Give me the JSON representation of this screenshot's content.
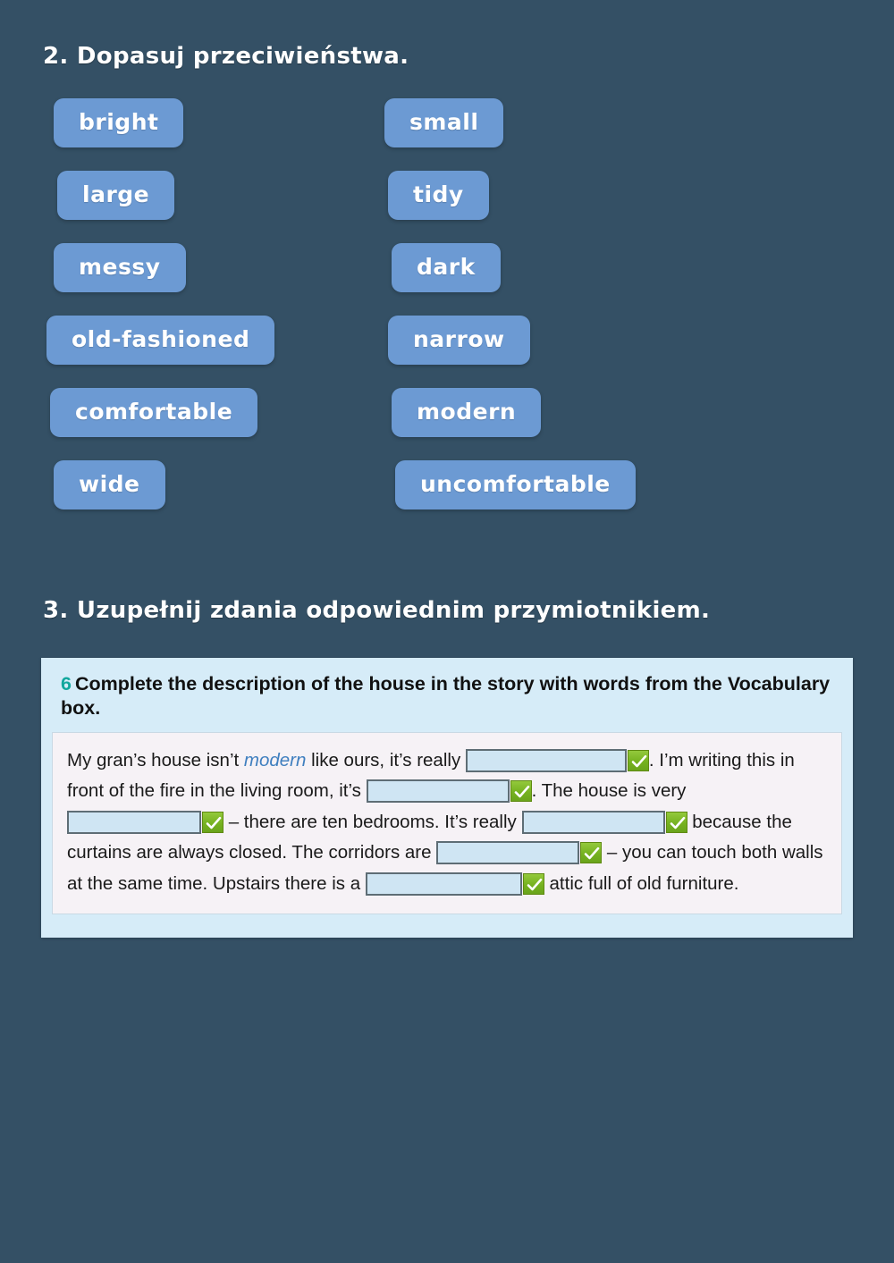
{
  "page": {
    "background_color": "#345065",
    "word_box_color": "#6c9ad3",
    "panel_color": "#d6ecf8",
    "panel_body_color": "#f6f2f6",
    "accent_color": "#12a79d",
    "check_color": "#76b220"
  },
  "exercise2": {
    "heading": "2. Dopasuj przeciwieństwa.",
    "left_column": [
      {
        "label": "bright"
      },
      {
        "label": "large"
      },
      {
        "label": "messy"
      },
      {
        "label": "old-fashioned"
      },
      {
        "label": "comfortable"
      },
      {
        "label": "wide"
      }
    ],
    "right_column": [
      {
        "label": "small"
      },
      {
        "label": "tidy"
      },
      {
        "label": "dark"
      },
      {
        "label": "narrow"
      },
      {
        "label": "modern"
      },
      {
        "label": "uncomfortable"
      }
    ]
  },
  "exercise3": {
    "heading": "3. Uzupełnij zdania odpowiednim przymiotnikiem.",
    "panel": {
      "number": "6",
      "instruction": "Complete the description of the house in the story with words from the Vocabulary box.",
      "text_segments": {
        "s1": "My gran’s house isn’t ",
        "highlight": "modern",
        "s2": " like ours, it’s really ",
        "s3": ". I’m writing this in front of the fire in the living room, it’s ",
        "s4": ". The house is very ",
        "s5": " – there are ten bedrooms. It’s really ",
        "s6": " because the curtains are always closed. The corridors are ",
        "s7": " – you can touch both walls at the same time. Upstairs there is a ",
        "s8": " attic full of old furniture."
      },
      "blanks": [
        {
          "id": "blank-1",
          "value": "",
          "checked_icon": "check-icon"
        },
        {
          "id": "blank-2",
          "value": "",
          "checked_icon": "check-icon"
        },
        {
          "id": "blank-3",
          "value": "",
          "checked_icon": "check-icon"
        },
        {
          "id": "blank-4",
          "value": "",
          "checked_icon": "check-icon"
        },
        {
          "id": "blank-5",
          "value": "",
          "checked_icon": "check-icon"
        },
        {
          "id": "blank-6",
          "value": "",
          "checked_icon": "check-icon"
        }
      ]
    }
  }
}
